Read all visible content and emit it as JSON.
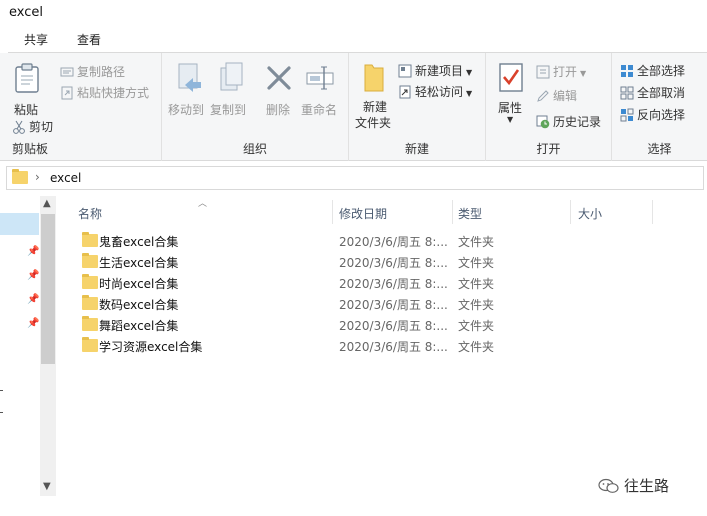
{
  "window": {
    "title": "excel"
  },
  "tabs": [
    {
      "label": "共享"
    },
    {
      "label": "查看"
    }
  ],
  "ribbon": {
    "clipboard": {
      "label": "剪贴板",
      "paste": "粘贴",
      "copy_path": "复制路径",
      "paste_shortcut": "粘贴快捷方式",
      "cut": "剪切"
    },
    "organize": {
      "label": "组织",
      "move_to": "移动到",
      "copy_to": "复制到",
      "delete": "删除",
      "rename": "重命名"
    },
    "new": {
      "label": "新建",
      "new_folder_line1": "新建",
      "new_folder_line2": "文件夹",
      "new_item": "新建项目",
      "easy_access": "轻松访问"
    },
    "open": {
      "label": "打开",
      "properties": "属性",
      "open": "打开",
      "edit": "编辑",
      "history": "历史记录"
    },
    "select": {
      "label": "选择",
      "select_all": "全部选择",
      "select_none": "全部取消",
      "invert": "反向选择"
    }
  },
  "address": {
    "path": "excel",
    "separator": "›"
  },
  "columns": {
    "name": "名称",
    "date": "修改日期",
    "type": "类型",
    "size": "大小"
  },
  "files": [
    {
      "name": "鬼畜excel合集",
      "date": "2020/3/6/周五 8:...",
      "type": "文件夹"
    },
    {
      "name": "生活excel合集",
      "date": "2020/3/6/周五 8:...",
      "type": "文件夹"
    },
    {
      "name": "时尚excel合集",
      "date": "2020/3/6/周五 8:...",
      "type": "文件夹"
    },
    {
      "name": "数码excel合集",
      "date": "2020/3/6/周五 8:...",
      "type": "文件夹"
    },
    {
      "name": "舞蹈excel合集",
      "date": "2020/3/6/周五 8:...",
      "type": "文件夹"
    },
    {
      "name": "学习资源excel合集",
      "date": "2020/3/6/周五 8:...",
      "type": "文件夹"
    }
  ],
  "watermark": {
    "text": "往生路"
  },
  "colors": {
    "accent": "#1e6fc2",
    "folder": "#f6d36b",
    "selection": "#cde6f7",
    "ribbon_bg": "#f5f6f7"
  }
}
